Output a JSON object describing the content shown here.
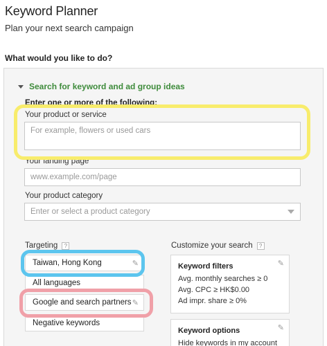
{
  "header": {
    "title": "Keyword Planner",
    "subtitle": "Plan your next search campaign"
  },
  "question": "What would you like to do?",
  "search_section": {
    "disclosure_label": "Search for keyword and ad group ideas",
    "enter_label": "Enter one or more of the following:",
    "product": {
      "label": "Your product or service",
      "placeholder": "For example, flowers or used cars"
    },
    "landing": {
      "label": "Your landing page",
      "placeholder": "www.example.com/page"
    },
    "category": {
      "label": "Your product category",
      "placeholder": "Enter or select a product category"
    }
  },
  "targeting": {
    "label": "Targeting",
    "help": "?",
    "items": [
      {
        "label": "Taiwan, Hong Kong"
      },
      {
        "label": "All languages"
      },
      {
        "label": "Google and search partners"
      },
      {
        "label": "Negative keywords"
      }
    ]
  },
  "customize": {
    "label": "Customize your search",
    "help": "?",
    "filters": {
      "title": "Keyword filters",
      "lines": [
        "Avg. monthly searches ≥ 0",
        "Avg. CPC ≥ HK$0.00",
        "Ad impr. share ≥ 0%"
      ]
    },
    "options": {
      "title": "Keyword options",
      "lines": [
        "Hide keywords in my account"
      ]
    }
  },
  "highlight_colors": {
    "yellow": "#f8ec6c",
    "blue": "#5cc5ee",
    "pink": "#f0a0a8"
  },
  "icons": [
    "pencil-icon",
    "help-icon",
    "disclosure-triangle-icon",
    "dropdown-caret-icon"
  ]
}
